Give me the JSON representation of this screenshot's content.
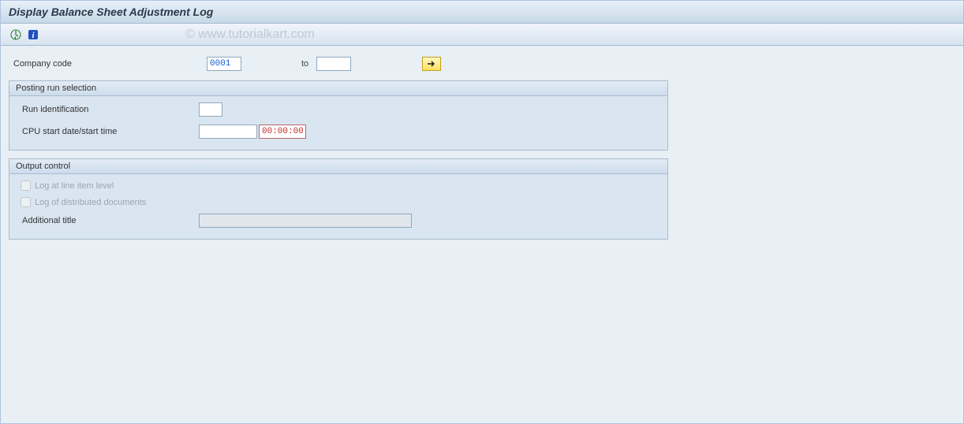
{
  "title": "Display Balance Sheet Adjustment Log",
  "watermark": "© www.tutorialkart.com",
  "fields": {
    "company_code": {
      "label": "Company code",
      "value": "0001",
      "to_label": "to",
      "to_value": ""
    }
  },
  "groups": {
    "posting_run": {
      "title": "Posting run selection",
      "run_identification": {
        "label": "Run identification",
        "value": ""
      },
      "cpu_start": {
        "label": "CPU start date/start time",
        "date_value": "",
        "time_value": "00:00:00"
      }
    },
    "output_control": {
      "title": "Output control",
      "log_line_item": {
        "label": "Log at line item level",
        "checked": false,
        "disabled": true
      },
      "log_distributed": {
        "label": "Log of distributed documents",
        "checked": false,
        "disabled": true
      },
      "additional_title": {
        "label": "Additional title",
        "value": ""
      }
    }
  },
  "icons": {
    "execute": "execute-icon",
    "info": "info-icon",
    "multi_select": "arrow-right-icon"
  }
}
